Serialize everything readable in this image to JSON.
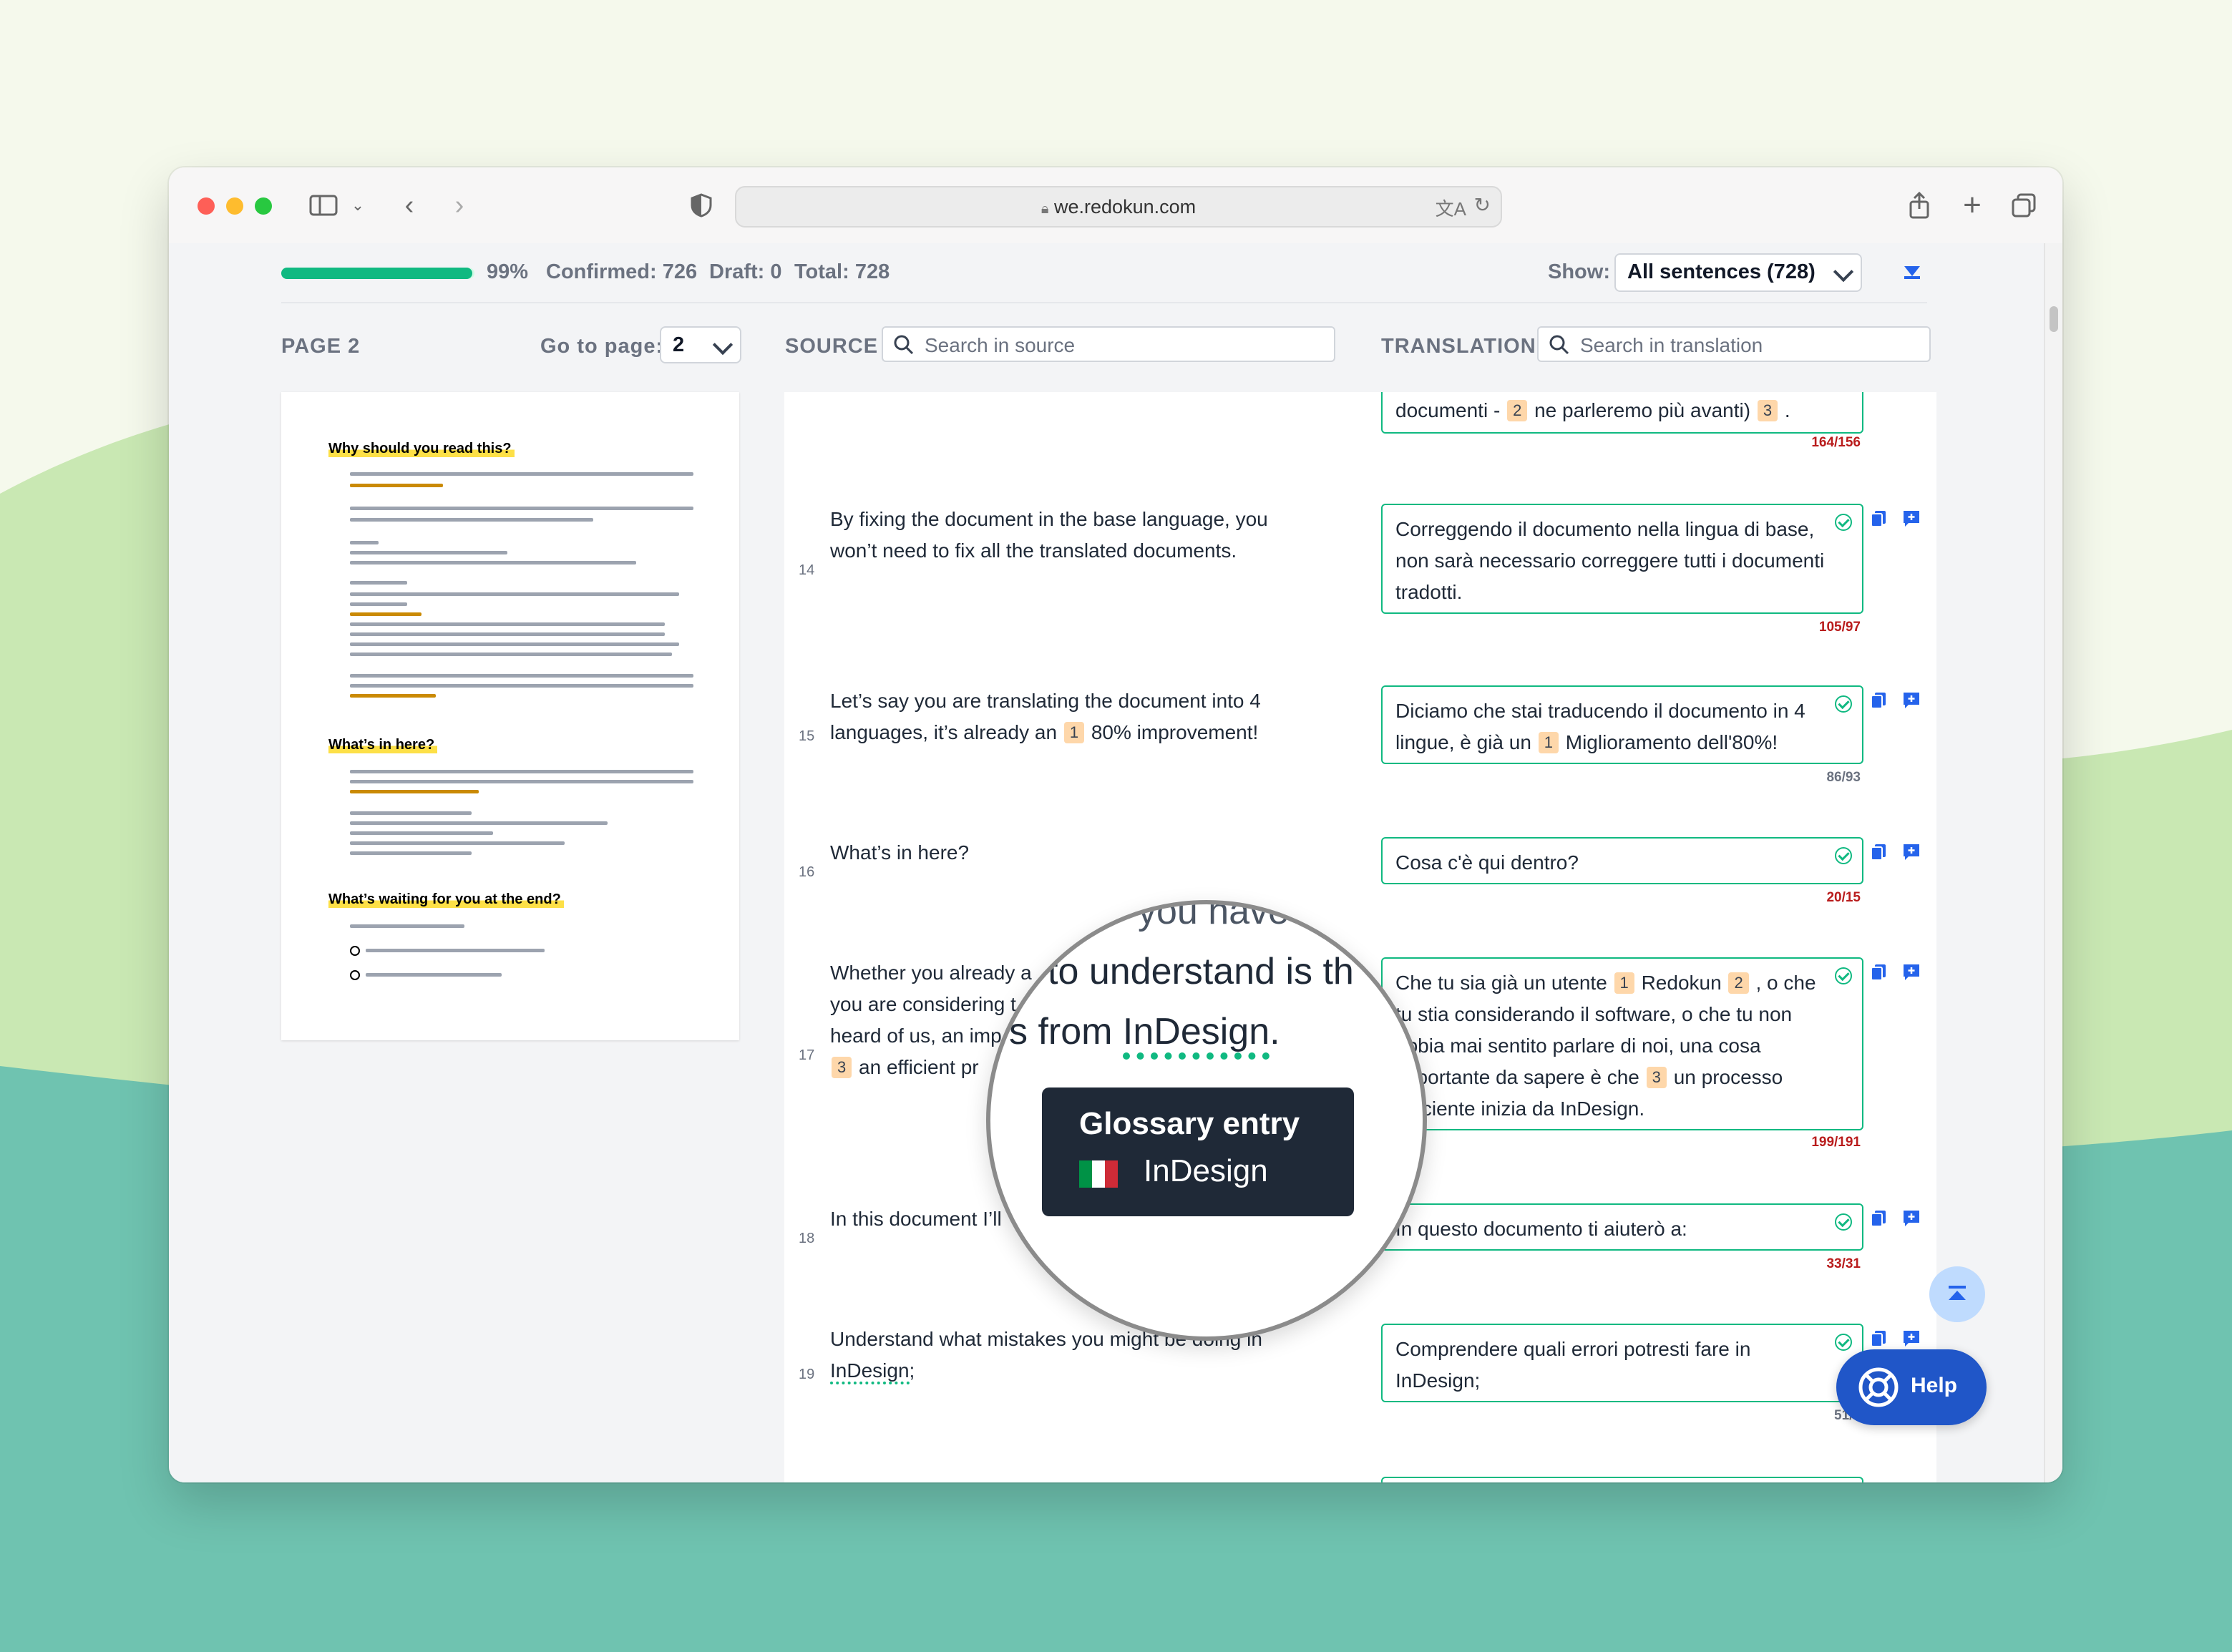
{
  "browser": {
    "url": "we.redokun.com"
  },
  "stats": {
    "progress": 0.99,
    "progress_label": "99%",
    "confirmed": "Confirmed: 726",
    "draft": "Draft: 0",
    "total": "Total: 728"
  },
  "filter": {
    "label": "Show:",
    "value": "All sentences (728)"
  },
  "left": {
    "page_label": "PAGE 2",
    "goto_label": "Go to page:",
    "goto_value": "2"
  },
  "source": {
    "label": "SOURCE",
    "placeholder": "Search in source"
  },
  "translation": {
    "label": "TRANSLATION",
    "placeholder": "Search in translation"
  },
  "thumbnail": {
    "h1": "Why should you read this?",
    "h2": "What’s in here?",
    "h3": "What’s waiting for you at the end?"
  },
  "rows": [
    {
      "num": "",
      "src": "",
      "trans_a": "documenti - ",
      "tag1": "2",
      "trans_b": " ne parleremo più avanti) ",
      "tag2": "3",
      "trans_c": " .",
      "count": "164/156"
    },
    {
      "num": "14",
      "src": "By fixing the document in the base language, you won’t need to fix all the translated documents.",
      "trans": "Correggendo il documento nella lingua di base, non sarà necessario correggere tutti i documenti tradotti.",
      "count": "105/97"
    },
    {
      "num": "15",
      "src_a": "Let’s say you are translating the document into 4 languages, it’s already an ",
      "src_tag": "1",
      "src_b": " 80% improvement!",
      "trans_a": "Diciamo che stai traducendo il documento in 4 lingue, è già un ",
      "trans_tag": "1",
      "trans_b": " Miglioramento dell'80%!",
      "count": "86/93"
    },
    {
      "num": "16",
      "src": "What’s in here?",
      "trans": "Cosa c'è qui dentro?",
      "count": "20/15"
    },
    {
      "num": "17",
      "src_l1": "Whether you already a",
      "src_l2": "you are considering t",
      "src_l3": "heard of us, an imp",
      "src_tag": "3",
      "src_l4": " an efficient pr",
      "trans_a": "Che tu sia già un utente ",
      "tag1": "1",
      "trans_b": " Redokun ",
      "tag2": "2",
      "trans_c": " , o che tu stia considerando il software, o che tu non abbia mai sentito parlare di noi, una cosa importante da sapere è che ",
      "tag3": "3",
      "trans_d": " un processo efficiente inizia da InDesign.",
      "count": "199/191"
    },
    {
      "num": "18",
      "src": "In this document I’ll",
      "trans": "In questo documento ti aiuterò a:",
      "count": "33/31"
    },
    {
      "num": "19",
      "src_a": "Understand what mistakes you might be doing in ",
      "src_gloss": "InDesign",
      "src_b": ";",
      "trans": "Comprendere quali errori potresti fare in InDesign;",
      "count": "51/5"
    }
  ],
  "lens": {
    "line1": "you have",
    "line2": "to understand is th",
    "line3_a": "s from ",
    "line3_gloss": "InDesign",
    "line3_b": ".",
    "tooltip_title": "Glossary entry",
    "tooltip_term": "InDesign"
  },
  "help": {
    "label": "Help"
  },
  "colors": {
    "accent": "#10b981",
    "brand_blue": "#2056c8",
    "tag_bg": "#fed7aa",
    "count_red": "#b91c1c"
  }
}
